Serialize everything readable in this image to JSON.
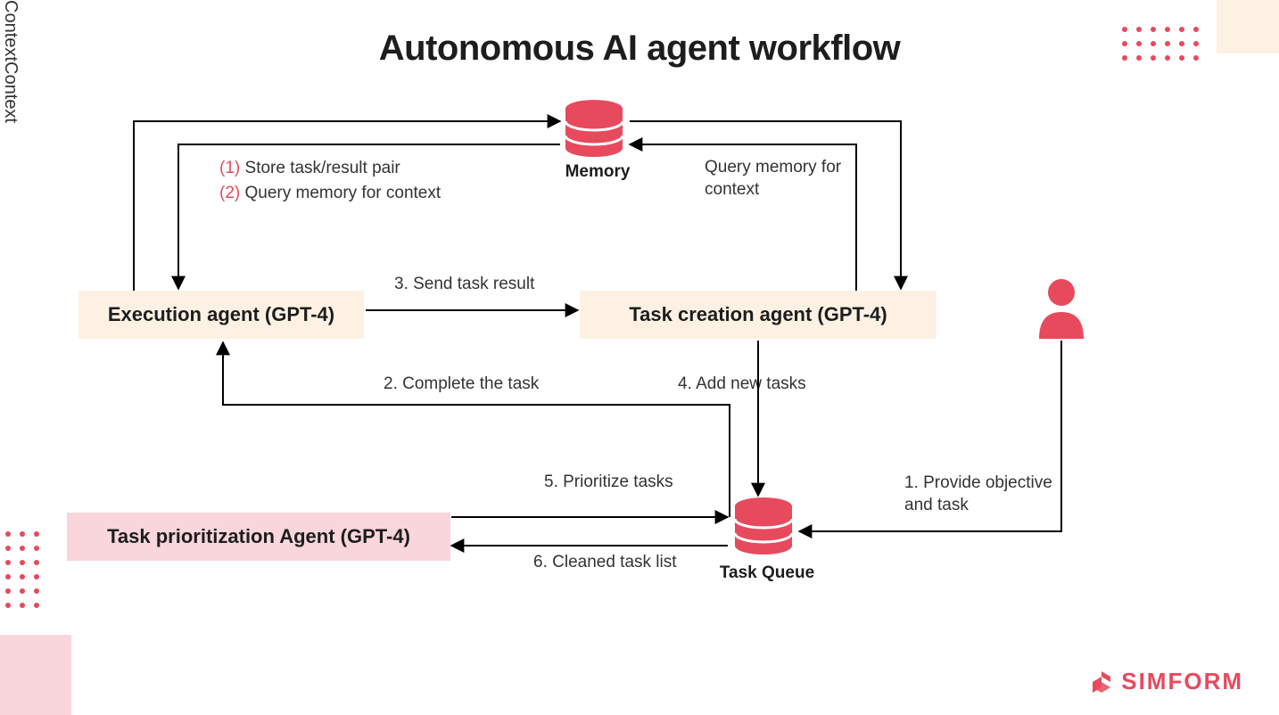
{
  "title": "Autonomous AI agent workflow",
  "nodes": {
    "memory": "Memory",
    "execution_agent": "Execution agent (GPT-4)",
    "task_creation_agent": "Task creation agent (GPT-4)",
    "task_prioritization_agent": "Task prioritization Agent (GPT-4)",
    "task_queue": "Task Queue"
  },
  "edges": {
    "context_left": "Context",
    "context_right": "Context",
    "store_pair_num": "(1)",
    "store_pair": "Store task/result pair",
    "query_context_num": "(2)",
    "query_context_left": "Query memory for context",
    "query_context_right": "Query memory for\ncontext",
    "step1": "1. Provide objective\nand task",
    "step2": "2. Complete the task",
    "step3": "3. Send task result",
    "step4": "4. Add new tasks",
    "step5": "5. Prioritize tasks",
    "step6": "6. Cleaned task list"
  },
  "brand": "SIMFORM",
  "colors": {
    "accent": "#e74a5d",
    "cream": "#fdf1e3",
    "pink": "#f9d6db"
  }
}
